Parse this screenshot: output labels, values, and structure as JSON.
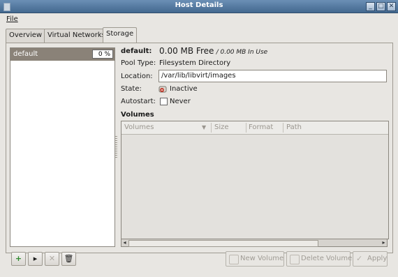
{
  "window": {
    "title": "Host Details"
  },
  "menu": {
    "file": "File"
  },
  "tabs": [
    "Overview",
    "Virtual Networks",
    "Storage"
  ],
  "pools": [
    {
      "name": "default",
      "usage": "0 %"
    }
  ],
  "details": {
    "pool_name": "default:",
    "free": "0.00 MB Free",
    "in_use": "/ 0.00 MB In Use",
    "pool_type_label": "Pool Type:",
    "pool_type": "Filesystem Directory",
    "location_label": "Location:",
    "location": "/var/lib/libvirt/images",
    "state_label": "State:",
    "state": "Inactive",
    "autostart_label": "Autostart:",
    "autostart": "Never",
    "volumes_title": "Volumes"
  },
  "volumes": {
    "columns": [
      "Volumes",
      "Size",
      "Format",
      "Path"
    ]
  },
  "buttons": {
    "add_pool": "+",
    "start_pool": "▸",
    "stop_pool": "✕",
    "delete_pool": "🗑",
    "new_volume": "New Volume",
    "delete_volume": "Delete Volume",
    "apply": "Apply"
  },
  "colors": {
    "titlebar": "#4f759d",
    "selection": "#8a8278",
    "window_bg": "#e8e6e2"
  }
}
